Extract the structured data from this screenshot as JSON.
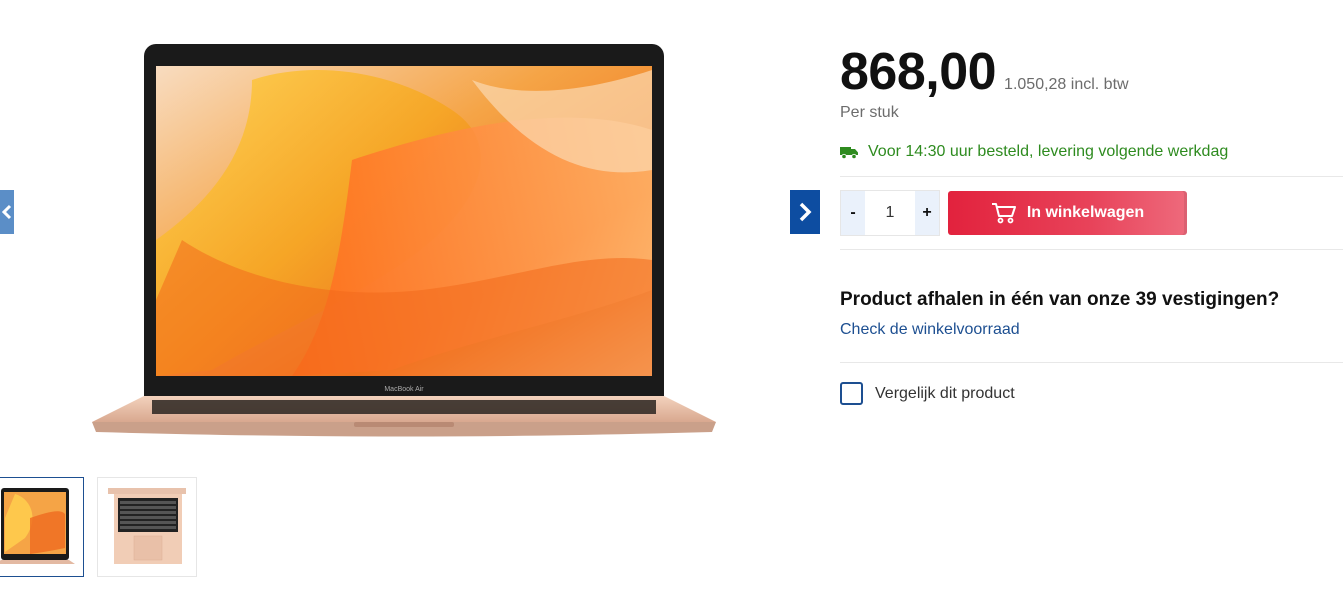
{
  "product": {
    "price": "868,00",
    "price_incl": "1.050,28 incl. btw",
    "per_unit": "Per stuk",
    "delivery_text": "Voor 14:30 uur besteld, levering volgende werkdag",
    "image_label": "MacBook Air"
  },
  "cart": {
    "minus_label": "-",
    "plus_label": "+",
    "quantity": "1",
    "add_label": "In winkelwagen"
  },
  "pickup": {
    "title": "Product afhalen in één van onze 39 vestigingen?",
    "link": "Check de winkelvoorraad"
  },
  "compare": {
    "label": "Vergelijk dit product"
  },
  "colors": {
    "accent_blue": "#0d4da1",
    "cart_red": "#e2223d",
    "delivery_green": "#2e8b1f"
  },
  "icons": {
    "prev": "chevron-left-icon",
    "next": "chevron-right-icon",
    "delivery": "truck-icon",
    "cart": "shopping-cart-icon"
  }
}
